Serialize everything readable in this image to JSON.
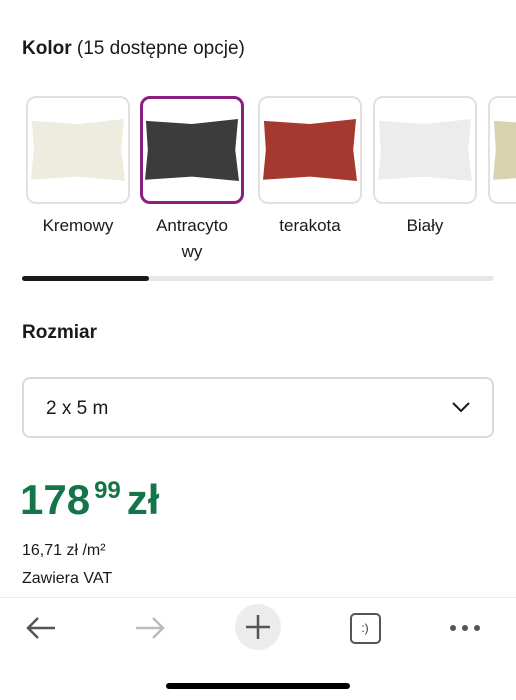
{
  "color_section": {
    "label": "Kolor",
    "count_text": "(15 dostępne opcje)",
    "swatches": [
      {
        "line1": "Kremowy",
        "line2": "",
        "color": "#eeebdf",
        "selected": false
      },
      {
        "line1": "Antracyto",
        "line2": "wy",
        "color": "#3c3c3c",
        "selected": true
      },
      {
        "line1": "terakota",
        "line2": "",
        "color": "#a5392f",
        "selected": false
      },
      {
        "line1": "Biały",
        "line2": "",
        "color": "#ececec",
        "selected": false
      }
    ],
    "selected_color": "#8a1e7f"
  },
  "size_section": {
    "label": "Rozmiar",
    "selected_value": "2 x 5 m"
  },
  "price": {
    "integer": "178",
    "decimal": "99",
    "currency": "zł",
    "unit_price": "16,71 zł /m²",
    "vat_note": "Zawiera VAT",
    "color": "#137548"
  },
  "browser_toolbar": {
    "icons": [
      "back-arrow-icon",
      "forward-arrow-icon",
      "new-tab-plus-icon",
      "tab-switcher-icon",
      "more-dots-icon"
    ],
    "tab_switcher_text": ":)"
  }
}
